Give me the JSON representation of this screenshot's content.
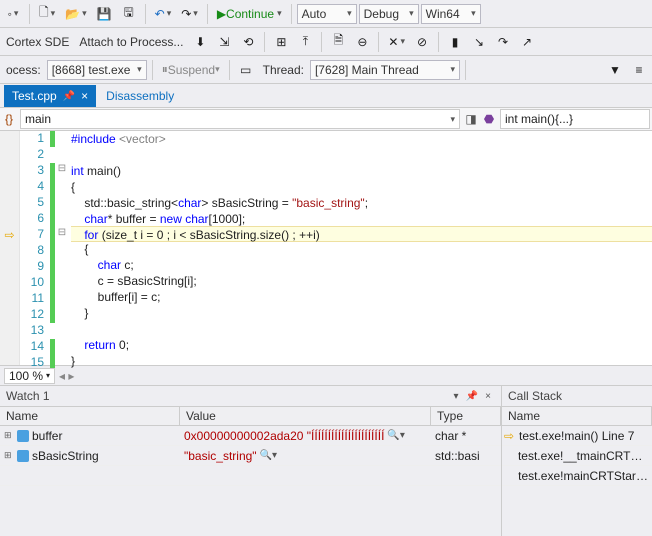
{
  "toolbar1": {
    "continue_label": "Continue",
    "config1": "Auto",
    "config2": "Debug",
    "config3": "Win64"
  },
  "toolbar2": {
    "item1": "Cortex SDE",
    "item2": "Attach to Process...",
    "suspend_label": "Suspend",
    "thread_label": "Thread:",
    "process_label": "ocess:",
    "process_value": "[8668] test.exe",
    "thread_value": "[7628] Main Thread"
  },
  "tabs": {
    "active": "Test.cpp",
    "inactive": "Disassembly"
  },
  "nav": {
    "scope": "main",
    "member": "int main(){...}",
    "scope_icon": "{}"
  },
  "code": {
    "lines": [
      {
        "n": 1,
        "green": true,
        "html": "<span class='kw'>#include</span> <span class='inc'>&lt;vector&gt;</span>"
      },
      {
        "n": 2,
        "green": false,
        "html": ""
      },
      {
        "n": 3,
        "green": true,
        "fold": "⊟",
        "html": "<span class='kw'>int</span> main()"
      },
      {
        "n": 4,
        "green": true,
        "html": "{"
      },
      {
        "n": 5,
        "green": true,
        "html": "    std::basic_string&lt;<span class='kw'>char</span>&gt; sBasicString = <span class='str'>\"basic_string\"</span>;"
      },
      {
        "n": 6,
        "green": true,
        "html": "    <span class='kw'>char</span>* buffer = <span class='kw'>new</span> <span class='kw'>char</span>[1000];"
      },
      {
        "n": 7,
        "green": true,
        "fold": "⊟",
        "current": true,
        "bp": true,
        "html": "    <span class='kw'>for</span> (size_t i = 0 ; i &lt; sBasicString.size() ; ++i)"
      },
      {
        "n": 8,
        "green": true,
        "html": "    {"
      },
      {
        "n": 9,
        "green": true,
        "html": "        <span class='kw'>char</span> c;"
      },
      {
        "n": 10,
        "green": true,
        "html": "        c = sBasicString[i];"
      },
      {
        "n": 11,
        "green": true,
        "html": "        buffer[i] = c;"
      },
      {
        "n": 12,
        "green": true,
        "html": "    }"
      },
      {
        "n": 13,
        "green": false,
        "html": ""
      },
      {
        "n": 14,
        "green": true,
        "html": "    <span class='kw'>return</span> 0;"
      },
      {
        "n": 15,
        "green": true,
        "html": "}"
      }
    ]
  },
  "zoom": "100 %",
  "watch": {
    "title": "Watch 1",
    "headers": {
      "name": "Name",
      "value": "Value",
      "type": "Type"
    },
    "rows": [
      {
        "name": "buffer",
        "value": "0x00000000002ada20 \"ÍÍÍÍÍÍÍÍÍÍÍÍÍÍÍÍÍÍÍÍÍÍ",
        "type": "char *"
      },
      {
        "name": "sBasicString",
        "value": "\"basic_string\"",
        "type": "std::basi"
      }
    ]
  },
  "callstack": {
    "title": "Call Stack",
    "header": "Name",
    "rows": [
      {
        "arrow": true,
        "text": "test.exe!main() Line 7"
      },
      {
        "arrow": false,
        "text": "test.exe!__tmainCRTStartu"
      },
      {
        "arrow": false,
        "text": "test.exe!mainCRTStartup()"
      }
    ]
  }
}
